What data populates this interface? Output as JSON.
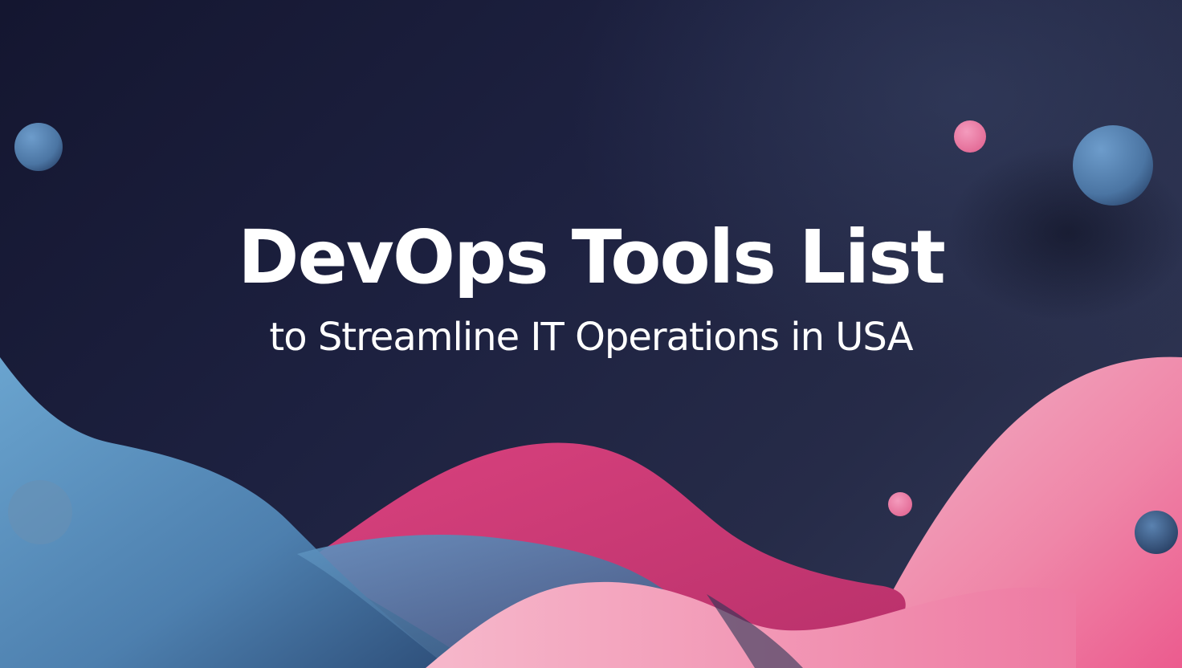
{
  "banner": {
    "title": "DevOps Tools List",
    "subtitle": "to Streamline IT Operations in USA"
  },
  "colors": {
    "background_dark": "#141630",
    "background_light": "#343c5a",
    "blue_wave": "#5a90bd",
    "pink_wave": "#e0508a",
    "light_pink": "#f5a8c2",
    "text": "#ffffff"
  }
}
